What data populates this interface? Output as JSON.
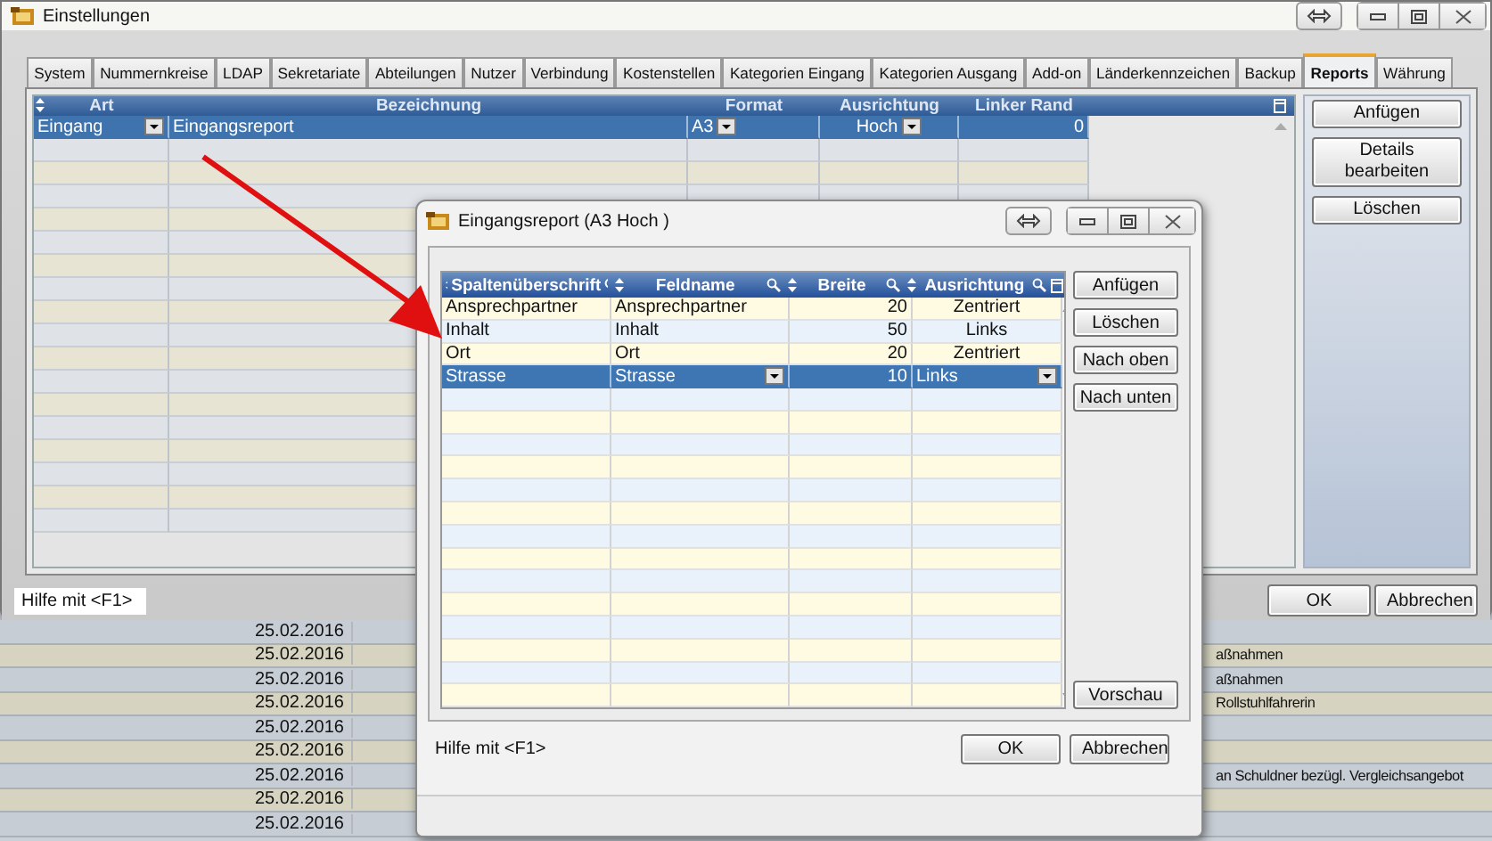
{
  "window": {
    "title": "Einstellungen"
  },
  "tabs": [
    {
      "label": "System",
      "selected": false
    },
    {
      "label": "Nummernkreise",
      "selected": false
    },
    {
      "label": "LDAP",
      "selected": false
    },
    {
      "label": "Sekretariate",
      "selected": false
    },
    {
      "label": "Abteilungen",
      "selected": false
    },
    {
      "label": "Nutzer",
      "selected": false
    },
    {
      "label": "Verbindung",
      "selected": false
    },
    {
      "label": "Kostenstellen",
      "selected": false
    },
    {
      "label": "Kategorien Eingang",
      "selected": false
    },
    {
      "label": "Kategorien Ausgang",
      "selected": false
    },
    {
      "label": "Add-on",
      "selected": false
    },
    {
      "label": "Länderkennzeichen",
      "selected": false
    },
    {
      "label": "Backup",
      "selected": false
    },
    {
      "label": "Reports",
      "selected": true
    },
    {
      "label": "Währung",
      "selected": false
    }
  ],
  "reports_table": {
    "columns": [
      {
        "label": "Art",
        "dropdown": true
      },
      {
        "label": "Bezeichnung",
        "dropdown": false
      },
      {
        "label": "Format",
        "dropdown": true
      },
      {
        "label": "Ausrichtung",
        "dropdown": true
      },
      {
        "label": "Linker Rand",
        "dropdown": false
      }
    ],
    "rows": [
      {
        "cells": [
          "Eingang",
          "Eingangsreport",
          "A3",
          "Hoch",
          "0"
        ],
        "selected": true
      }
    ]
  },
  "side_buttons": [
    "Anfügen",
    "Details bearbeiten",
    "Löschen"
  ],
  "status": "Hilfe mit <F1>",
  "footer_buttons": [
    "OK",
    "Abbrechen"
  ],
  "dialog": {
    "title": "Eingangsreport (A3 Hoch )",
    "columns": [
      {
        "label": "Spaltenüberschrift",
        "dropdown": false
      },
      {
        "label": "Feldname",
        "dropdown": true
      },
      {
        "label": "Breite",
        "dropdown": false
      },
      {
        "label": "Ausrichtung",
        "dropdown": true
      }
    ],
    "rows": [
      {
        "cells": [
          "Ansprechpartner",
          "Ansprechpartner",
          "20",
          "Zentriert"
        ],
        "selected": false
      },
      {
        "cells": [
          "Inhalt",
          "Inhalt",
          "50",
          "Links"
        ],
        "selected": false
      },
      {
        "cells": [
          "Ort",
          "Ort",
          "20",
          "Zentriert"
        ],
        "selected": false
      },
      {
        "cells": [
          "Strasse",
          "Strasse",
          "10",
          "Links"
        ],
        "selected": true
      }
    ],
    "side_buttons": [
      "Anfügen",
      "Löschen",
      "Nach oben",
      "Nach unten"
    ],
    "preview_button": "Vorschau",
    "status": "Hilfe mit <F1>",
    "footer_buttons": [
      "OK",
      "Abbrechen"
    ]
  },
  "background_list": [
    {
      "date": "25.02.2016"
    },
    {
      "date": "25.02.2016",
      "text": "aßnahmen"
    },
    {
      "date": "25.02.2016",
      "text": "aßnahmen"
    },
    {
      "date": "25.02.2016",
      "text": "Rollstuhlfahrerin"
    },
    {
      "date": "25.02.2016"
    },
    {
      "date": "25.02.2016"
    },
    {
      "date": "25.02.2016",
      "text": "an Schuldner bezügl. Vergleichsangebot"
    },
    {
      "date": "25.02.2016"
    },
    {
      "date": "25.02.2016"
    }
  ]
}
